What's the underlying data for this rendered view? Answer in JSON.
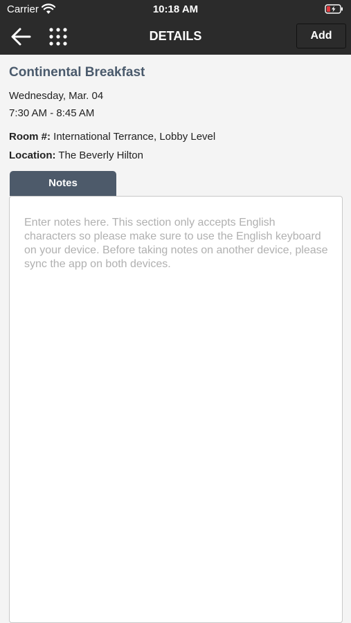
{
  "status_bar": {
    "carrier": "Carrier",
    "time": "10:18 AM",
    "wifi_icon": "wifi-icon",
    "battery_icon": "battery-charging-icon",
    "battery_color": "#e0393e"
  },
  "nav": {
    "title": "DETAILS",
    "back_icon": "arrow-left-icon",
    "menu_icon": "grid-dots-icon",
    "add_label": "Add"
  },
  "event": {
    "title": "Continental Breakfast",
    "date": "Wednesday, Mar. 04",
    "time": "7:30 AM - 8:45 AM",
    "room_label": "Room #:",
    "room_value": "International Terrance, Lobby Level",
    "location_label": "Location:",
    "location_value": "The Beverly Hilton"
  },
  "notes": {
    "tab_label": "Notes",
    "value": "",
    "placeholder": "Enter notes here. This section only accepts English characters so please make sure to use the English keyboard on your device. Before taking notes on another device, please sync the app on both devices."
  },
  "colors": {
    "header_bg": "#2b2b2b",
    "title_color": "#4a5a6c",
    "tab_bg": "#4d5a6a",
    "page_bg": "#f4f4f4"
  }
}
